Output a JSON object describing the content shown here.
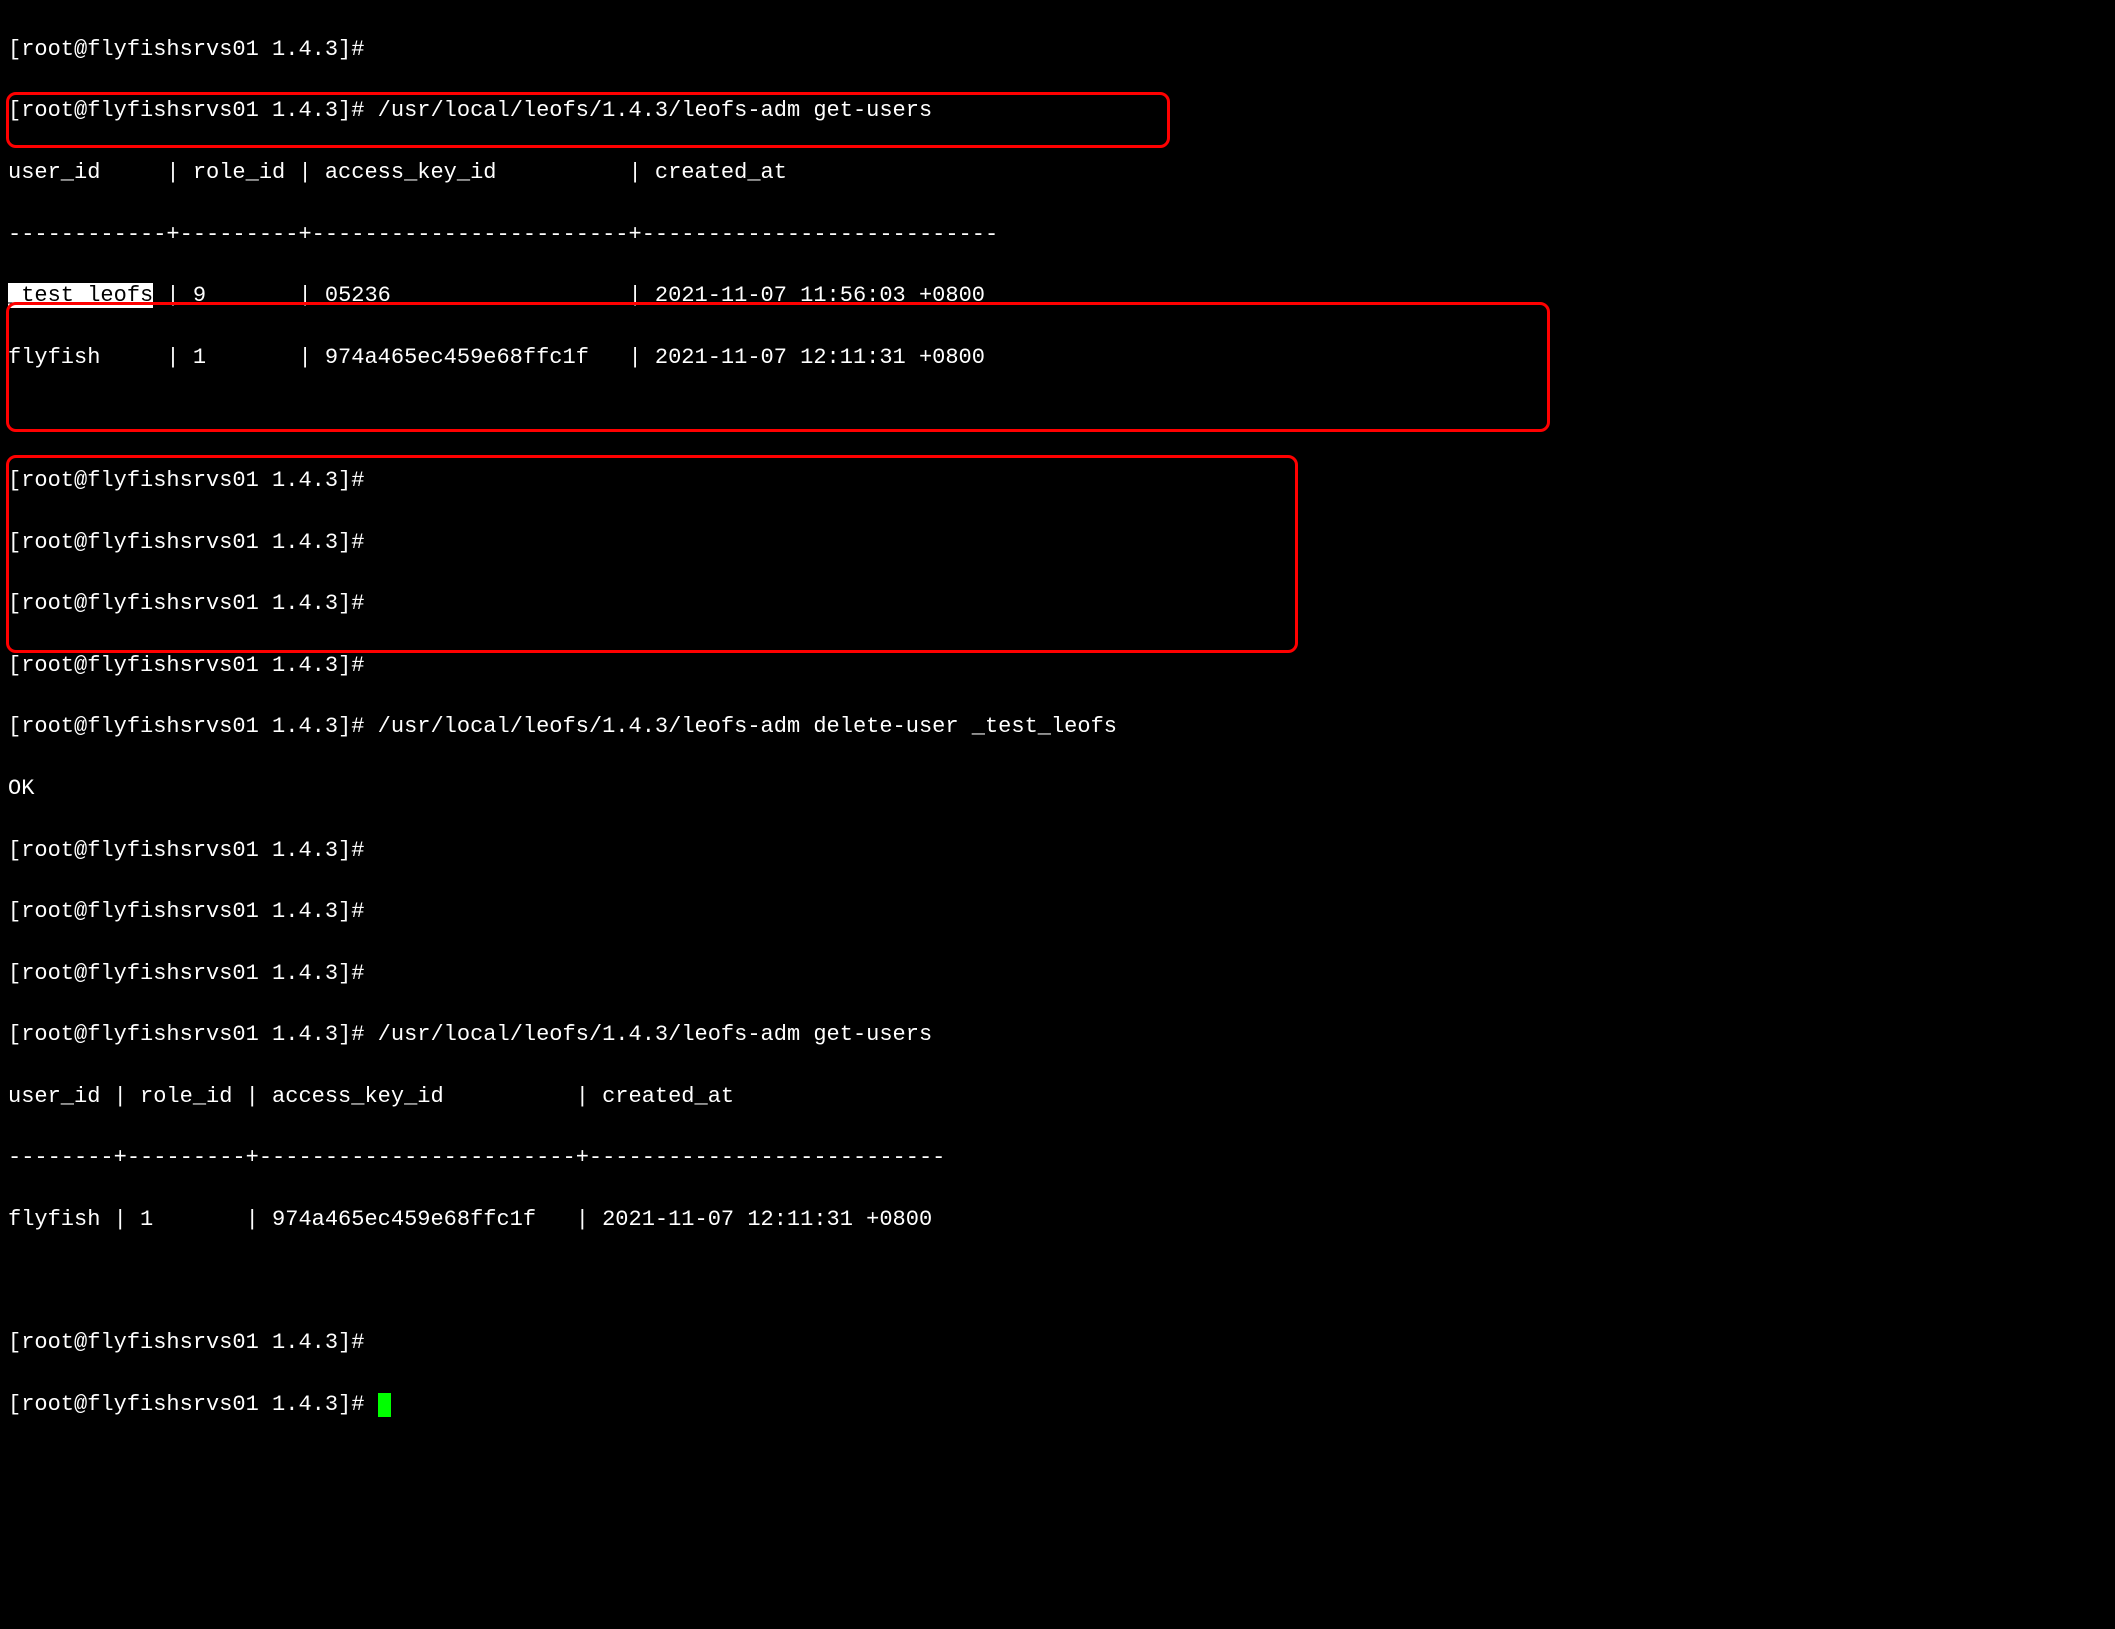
{
  "prompt": "[root@flyfishsrvs01 1.4.3]#",
  "cmd_get_users": "/usr/local/leofs/1.4.3/leofs-adm get-users",
  "cmd_delete_user": "/usr/local/leofs/1.4.3/leofs-adm delete-user _test_leofs",
  "delete_user_target": "_test_leofs",
  "ok": "OK",
  "table1": {
    "header": "user_id     | role_id | access_key_id          | created_at",
    "separator": "------------+---------+------------------------+---------------------------",
    "rows": [
      {
        "user_id_highlighted": "_test_leofs",
        "rest": " | 9       | 05236                  | 2021-11-07 11:56:03 +0800",
        "user_id": "_test_leofs",
        "role_id": "9",
        "access_key_id": "05236",
        "created_at": "2021-11-07 11:56:03 +0800"
      },
      {
        "line": "flyfish     | 1       | 974a465ec459e68ffc1f   | 2021-11-07 12:11:31 +0800",
        "user_id": "flyfish",
        "role_id": "1",
        "access_key_id": "974a465ec459e68ffc1f",
        "created_at": "2021-11-07 12:11:31 +0800"
      }
    ]
  },
  "table2": {
    "header": "user_id | role_id | access_key_id          | created_at",
    "separator": "--------+---------+------------------------+---------------------------",
    "rows": [
      {
        "line": "flyfish | 1       | 974a465ec459e68ffc1f   | 2021-11-07 12:11:31 +0800",
        "user_id": "flyfish",
        "role_id": "1",
        "access_key_id": "974a465ec459e68ffc1f",
        "created_at": "2021-11-07 12:11:31 +0800"
      }
    ]
  },
  "colors": {
    "annotation_box": "#ff0000",
    "cursor": "#00ff00",
    "bg": "#000000",
    "fg": "#ffffff"
  }
}
